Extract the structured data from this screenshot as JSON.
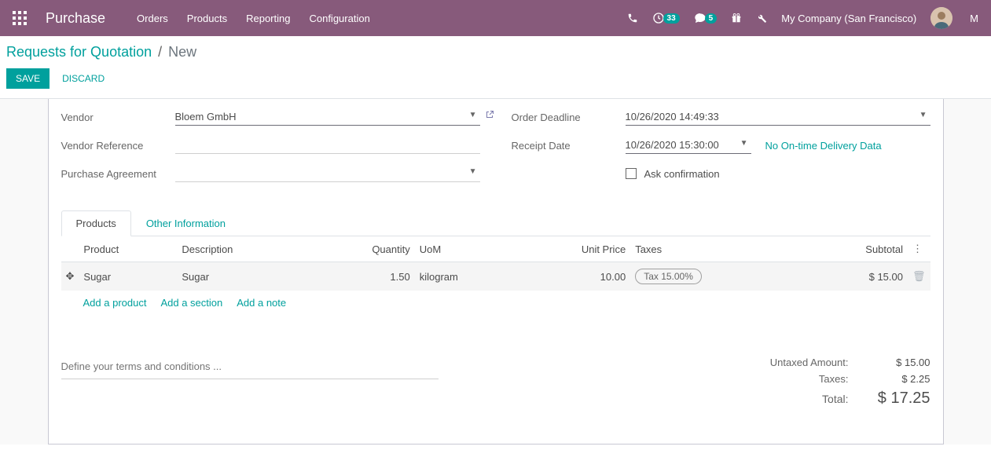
{
  "navbar": {
    "brand": "Purchase",
    "menu": [
      "Orders",
      "Products",
      "Reporting",
      "Configuration"
    ],
    "activity_count": "33",
    "messages_count": "5",
    "company": "My Company (San Francisco)",
    "user_initial": "M"
  },
  "breadcrumb": {
    "parent": "Requests for Quotation",
    "current": "New"
  },
  "buttons": {
    "save": "Save",
    "discard": "Discard"
  },
  "form": {
    "vendor_label": "Vendor",
    "vendor_value": "Bloem GmbH",
    "vendor_ref_label": "Vendor Reference",
    "vendor_ref_value": "",
    "purchase_agreement_label": "Purchase Agreement",
    "purchase_agreement_value": "",
    "order_deadline_label": "Order Deadline",
    "order_deadline_value": "10/26/2020 14:49:33",
    "receipt_date_label": "Receipt Date",
    "receipt_date_value": "10/26/2020 15:30:00",
    "receipt_link": "No On-time Delivery Data",
    "ask_confirmation_label": "Ask confirmation"
  },
  "tabs": {
    "products": "Products",
    "other": "Other Information"
  },
  "table": {
    "headers": {
      "product": "Product",
      "description": "Description",
      "quantity": "Quantity",
      "uom": "UoM",
      "unit_price": "Unit Price",
      "taxes": "Taxes",
      "subtotal": "Subtotal"
    },
    "rows": [
      {
        "product": "Sugar",
        "description": "Sugar",
        "quantity": "1.50",
        "uom": "kilogram",
        "unit_price": "10.00",
        "tax": "Tax 15.00%",
        "subtotal": "$ 15.00"
      }
    ],
    "add_product": "Add a product",
    "add_section": "Add a section",
    "add_note": "Add a note"
  },
  "terms_placeholder": "Define your terms and conditions ...",
  "totals": {
    "untaxed_label": "Untaxed Amount:",
    "untaxed_value": "$ 15.00",
    "taxes_label": "Taxes:",
    "taxes_value": "$ 2.25",
    "total_label": "Total:",
    "total_value": "$ 17.25"
  }
}
